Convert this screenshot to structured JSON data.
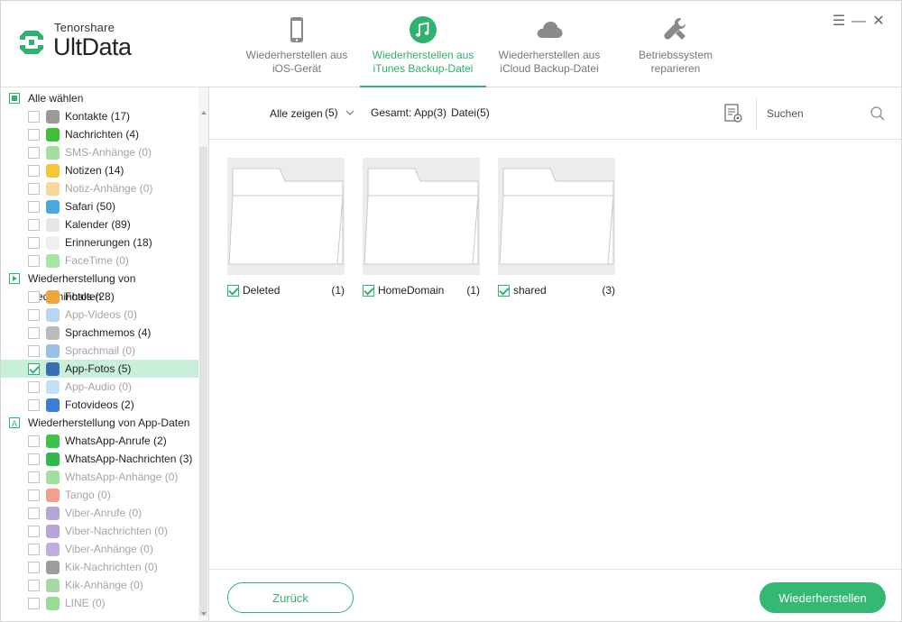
{
  "app": {
    "brand": "Tenorshare",
    "product": "UltData",
    "accent_color": "#2fb26d"
  },
  "nav": {
    "tabs": [
      {
        "label_line1": "Wiederherstellen aus",
        "label_line2": "iOS-Gerät",
        "icon": "phone-icon",
        "active": false
      },
      {
        "label_line1": "Wiederherstellen aus",
        "label_line2": "iTunes Backup-Datei",
        "icon": "music-note-icon",
        "active": true
      },
      {
        "label_line1": "Wiederherstellen aus",
        "label_line2": "iCloud Backup-Datei",
        "icon": "cloud-icon",
        "active": false
      },
      {
        "label_line1": "Betriebssystem",
        "label_line2": "reparieren",
        "icon": "wrench-icon",
        "active": false
      }
    ]
  },
  "window_controls": {
    "menu": "☰",
    "minimize": "—",
    "close": "✕"
  },
  "sidebar": {
    "select_all": "Alle wählen",
    "sections": [
      {
        "items": [
          {
            "label": "Kontakte (17)",
            "enabled": true,
            "checked": false,
            "icon": "contacts-icon",
            "color": "#9a9a9a"
          },
          {
            "label": "Nachrichten (4)",
            "enabled": true,
            "checked": false,
            "icon": "messages-icon",
            "color": "#3ec13a"
          },
          {
            "label": "SMS-Anhänge (0)",
            "enabled": false,
            "checked": false,
            "icon": "attachment-icon",
            "color": "#55c24f"
          },
          {
            "label": "Notizen (14)",
            "enabled": true,
            "checked": false,
            "icon": "notes-icon",
            "color": "#f6c73b"
          },
          {
            "label": "Notiz-Anhänge (0)",
            "enabled": false,
            "checked": false,
            "icon": "attachment-icon",
            "color": "#f0b54a"
          },
          {
            "label": "Safari (50)",
            "enabled": true,
            "checked": false,
            "icon": "safari-icon",
            "color": "#49a8e0"
          },
          {
            "label": "Kalender (89)",
            "enabled": true,
            "checked": false,
            "icon": "calendar-icon",
            "color": "#e6e6e6"
          },
          {
            "label": "Erinnerungen (18)",
            "enabled": true,
            "checked": false,
            "icon": "reminders-icon",
            "color": "#efefef"
          },
          {
            "label": "FaceTime (0)",
            "enabled": false,
            "checked": false,
            "icon": "facetime-icon",
            "color": "#5fd05a"
          }
        ]
      },
      {
        "title": "Wiederherstellung von Medieninhalten",
        "items": [
          {
            "label": "Fotos (28)",
            "enabled": true,
            "checked": false,
            "icon": "photos-icon",
            "color": "#f3a33b"
          },
          {
            "label": "App-Videos (0)",
            "enabled": false,
            "checked": false,
            "icon": "video-icon",
            "color": "#7fb6e8"
          },
          {
            "label": "Sprachmemos (4)",
            "enabled": true,
            "checked": false,
            "icon": "waveform-icon",
            "color": "#bbbbbb"
          },
          {
            "label": "Sprachmail (0)",
            "enabled": false,
            "checked": false,
            "icon": "voicemail-icon",
            "color": "#3c8fde"
          },
          {
            "label": "App-Fotos (5)",
            "enabled": true,
            "checked": true,
            "selected": true,
            "icon": "landscape-icon",
            "color": "#3a6fb3"
          },
          {
            "label": "App-Audio (0)",
            "enabled": false,
            "checked": false,
            "icon": "microphone-icon",
            "color": "#8ec5ee"
          },
          {
            "label": "Fotovideos (2)",
            "enabled": true,
            "checked": false,
            "icon": "photo-video-icon",
            "color": "#3a7ed6"
          }
        ]
      },
      {
        "title": "Wiederherstellung von App-Daten",
        "items": [
          {
            "label": "WhatsApp-Anrufe (2)",
            "enabled": true,
            "checked": false,
            "icon": "whatsapp-call-icon",
            "color": "#3dc34a"
          },
          {
            "label": "WhatsApp-Nachrichten (3)",
            "enabled": true,
            "checked": false,
            "icon": "whatsapp-icon",
            "color": "#2fb94a"
          },
          {
            "label": "WhatsApp-Anhänge (0)",
            "enabled": false,
            "checked": false,
            "icon": "attachment-icon",
            "color": "#55c24f"
          },
          {
            "label": "Tango (0)",
            "enabled": false,
            "checked": false,
            "icon": "tango-icon",
            "color": "#e9502e"
          },
          {
            "label": "Viber-Anrufe (0)",
            "enabled": false,
            "checked": false,
            "icon": "viber-call-icon",
            "color": "#7d5bb8"
          },
          {
            "label": "Viber-Nachrichten (0)",
            "enabled": false,
            "checked": false,
            "icon": "viber-icon",
            "color": "#7d5bb8"
          },
          {
            "label": "Viber-Anhänge (0)",
            "enabled": false,
            "checked": false,
            "icon": "attachment-icon",
            "color": "#8a6bc2"
          },
          {
            "label": "Kik-Nachrichten (0)",
            "enabled": false,
            "checked": false,
            "icon": "kik-icon",
            "color": "#4a4a4a"
          },
          {
            "label": "Kik-Anhänge (0)",
            "enabled": false,
            "checked": false,
            "icon": "attachment-icon",
            "color": "#5ab85a"
          },
          {
            "label": "LINE (0)",
            "enabled": false,
            "checked": false,
            "icon": "line-icon",
            "color": "#3ec13a"
          }
        ]
      }
    ]
  },
  "toolbar": {
    "filter_label": "Alle zeigen",
    "filter_count": "(5)",
    "summary_prefix": "Gesamt:",
    "summary_app": "App(3)",
    "summary_file": "Datei(5)",
    "search_placeholder": "Suchen"
  },
  "folders": [
    {
      "name": "Deleted",
      "count": "(1)",
      "checked": true
    },
    {
      "name": "HomeDomain",
      "count": "(1)",
      "checked": true
    },
    {
      "name": "shared",
      "count": "(3)",
      "checked": true
    }
  ],
  "footer": {
    "back_label": "Zurück",
    "restore_label": "Wiederherstellen"
  }
}
